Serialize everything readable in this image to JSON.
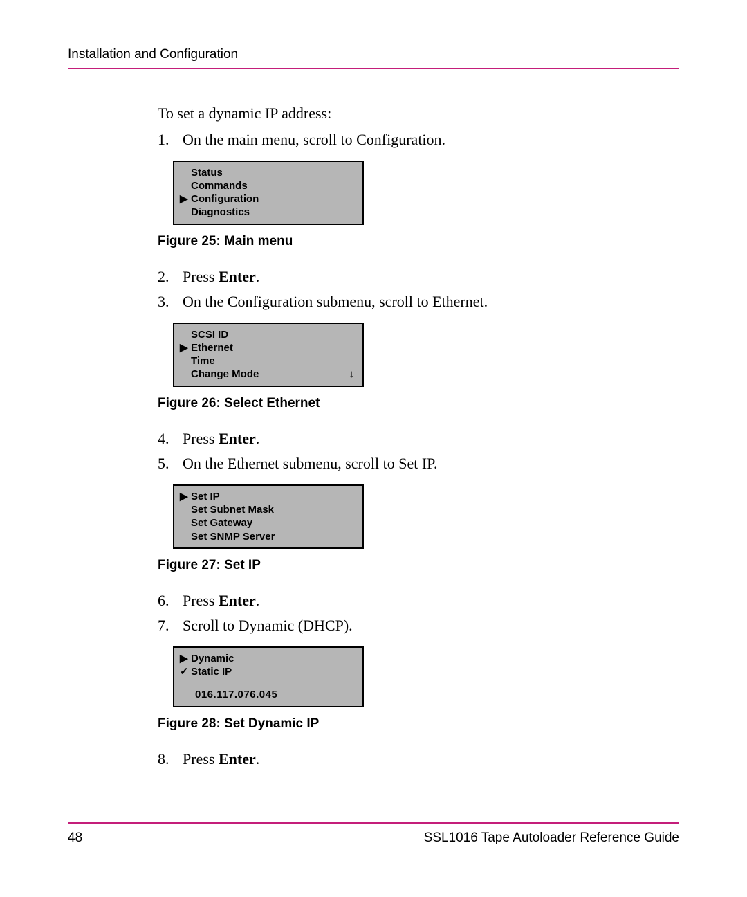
{
  "header": {
    "running_head": "Installation and Configuration"
  },
  "intro": "To set a dynamic IP address:",
  "steps": {
    "s1": {
      "num": "1.",
      "text": "On the main menu, scroll to Configuration."
    },
    "s2": {
      "num": "2.",
      "text_before": "Press ",
      "bold": "Enter",
      "text_after": "."
    },
    "s3": {
      "num": "3.",
      "text": "On the Configuration submenu, scroll to Ethernet."
    },
    "s4": {
      "num": "4.",
      "text_before": "Press ",
      "bold": "Enter",
      "text_after": "."
    },
    "s5": {
      "num": "5.",
      "text": "On the Ethernet submenu, scroll to Set IP."
    },
    "s6": {
      "num": "6.",
      "text_before": "Press ",
      "bold": "Enter",
      "text_after": "."
    },
    "s7": {
      "num": "7.",
      "text": "Scroll to Dynamic (DHCP)."
    },
    "s8": {
      "num": "8.",
      "text_before": "Press ",
      "bold": "Enter",
      "text_after": "."
    }
  },
  "figures": {
    "f25": {
      "caption": "Figure 25:  Main menu",
      "items": [
        {
          "marker": "",
          "label": "Status"
        },
        {
          "marker": "",
          "label": "Commands"
        },
        {
          "marker": "▶",
          "label": "Configuration"
        },
        {
          "marker": "",
          "label": "Diagnostics"
        }
      ]
    },
    "f26": {
      "caption": "Figure 26:  Select Ethernet",
      "items": [
        {
          "marker": "",
          "label": "SCSI ID"
        },
        {
          "marker": "▶",
          "label": "Ethernet"
        },
        {
          "marker": "",
          "label": "Time"
        },
        {
          "marker": "",
          "label": "Change Mode",
          "trail": "↓"
        }
      ]
    },
    "f27": {
      "caption": "Figure 27:  Set IP",
      "items": [
        {
          "marker": "▶",
          "label": "Set IP"
        },
        {
          "marker": "",
          "label": "Set Subnet Mask"
        },
        {
          "marker": "",
          "label": "Set Gateway"
        },
        {
          "marker": "",
          "label": "Set SNMP Server"
        }
      ]
    },
    "f28": {
      "caption": "Figure 28:  Set Dynamic IP",
      "items": [
        {
          "marker": "▶",
          "label": " Dynamic"
        },
        {
          "marker": "✓",
          "label": "Static IP"
        }
      ],
      "ip": "016.117.076.045"
    }
  },
  "footer": {
    "page": "48",
    "title": "SSL1016 Tape Autoloader Reference Guide"
  }
}
